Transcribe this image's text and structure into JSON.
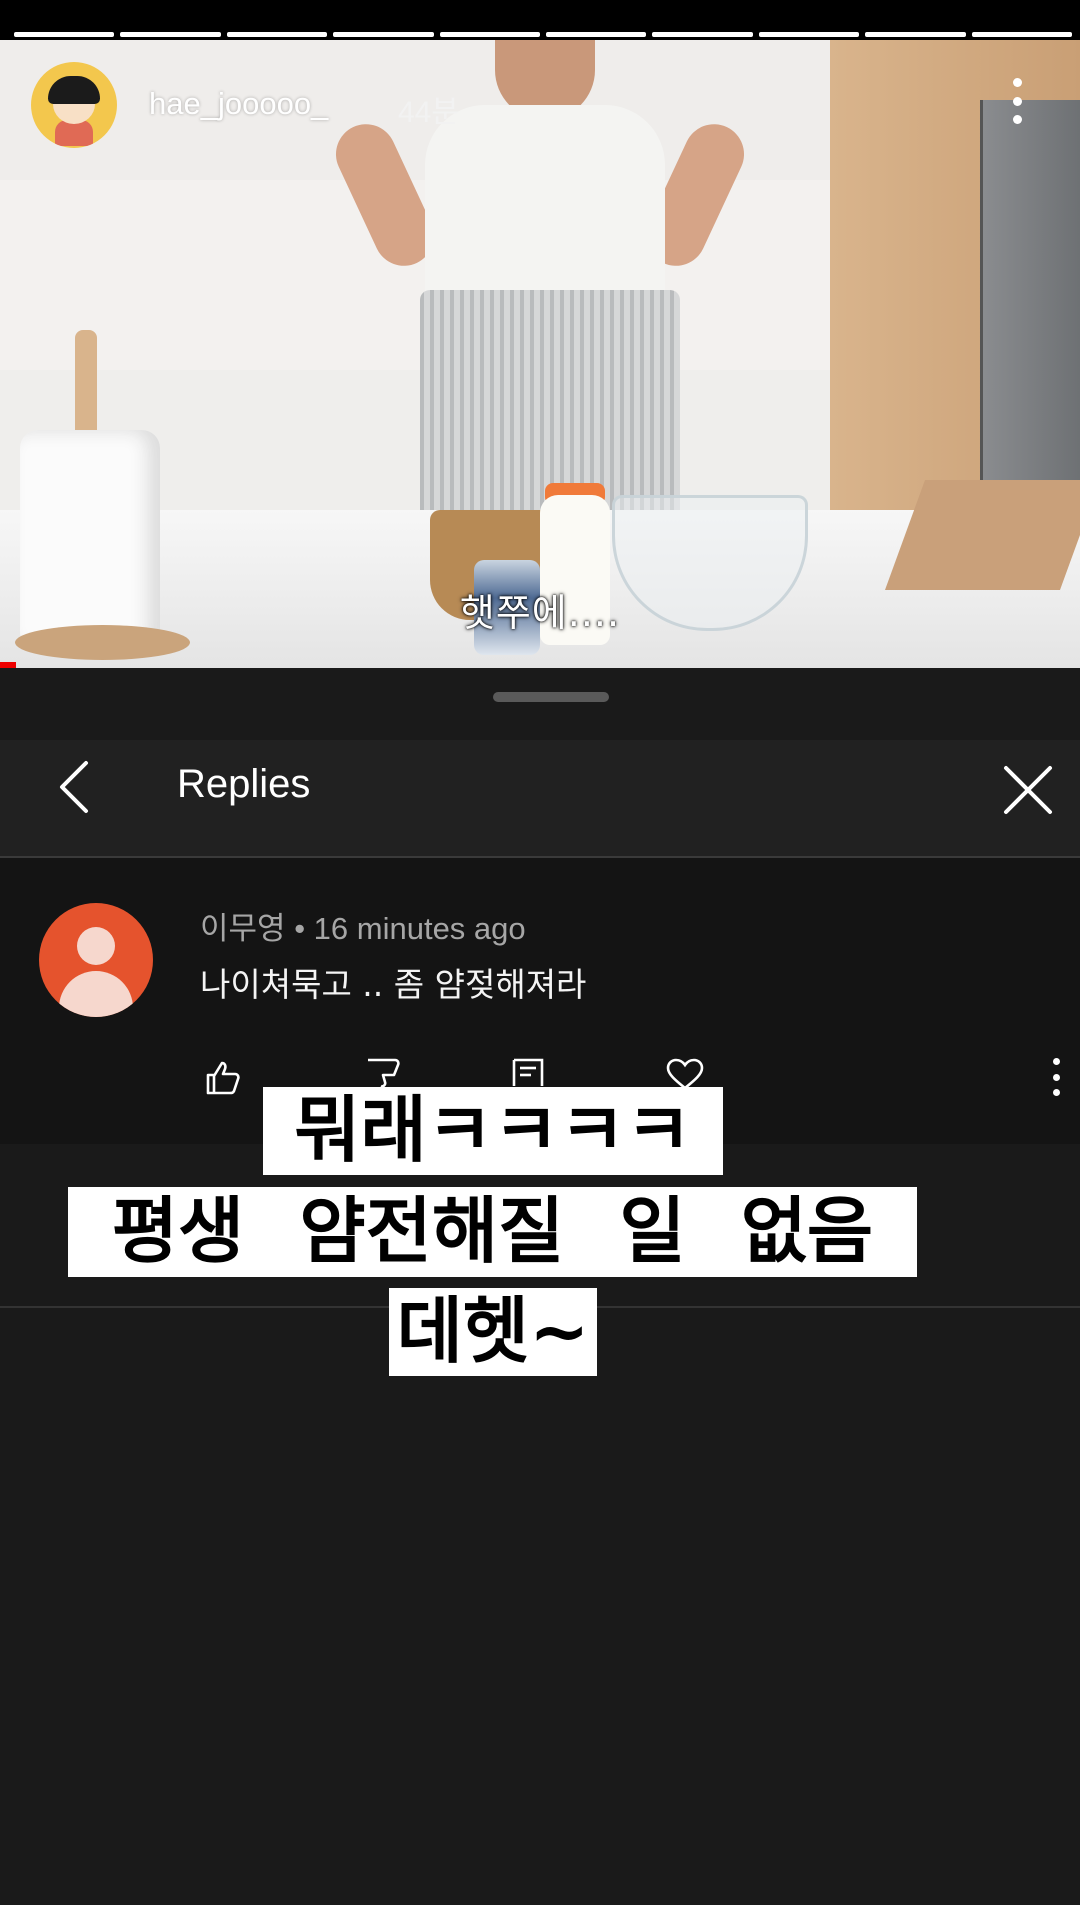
{
  "story": {
    "username": "hae_jooooo_",
    "time_ago": "44분",
    "segments_count": 10
  },
  "video": {
    "subtitle": "햇쭈에...."
  },
  "replies_panel": {
    "title": "Replies"
  },
  "comment": {
    "author": "이무영",
    "separator": "•",
    "timestamp": "16 minutes ago",
    "text": "나이쳐묵고 .. 좀 얌젖해져라"
  },
  "captions": {
    "line1": "뭐래ㅋㅋㅋㅋ",
    "line2": "평생 얌전해질 일 없음",
    "line3": "데헷~"
  },
  "icons": {
    "back": "chevron-left-icon",
    "close": "close-icon",
    "like": "thumbs-up-icon",
    "dislike": "thumbs-down-icon",
    "reply": "reply-icon",
    "heart": "heart-icon",
    "more": "more-vertical-icon"
  },
  "colors": {
    "sheet_bg": "#1a1a1a",
    "profile_bg": "#e5532d",
    "caption_bg": "#ffffff"
  }
}
